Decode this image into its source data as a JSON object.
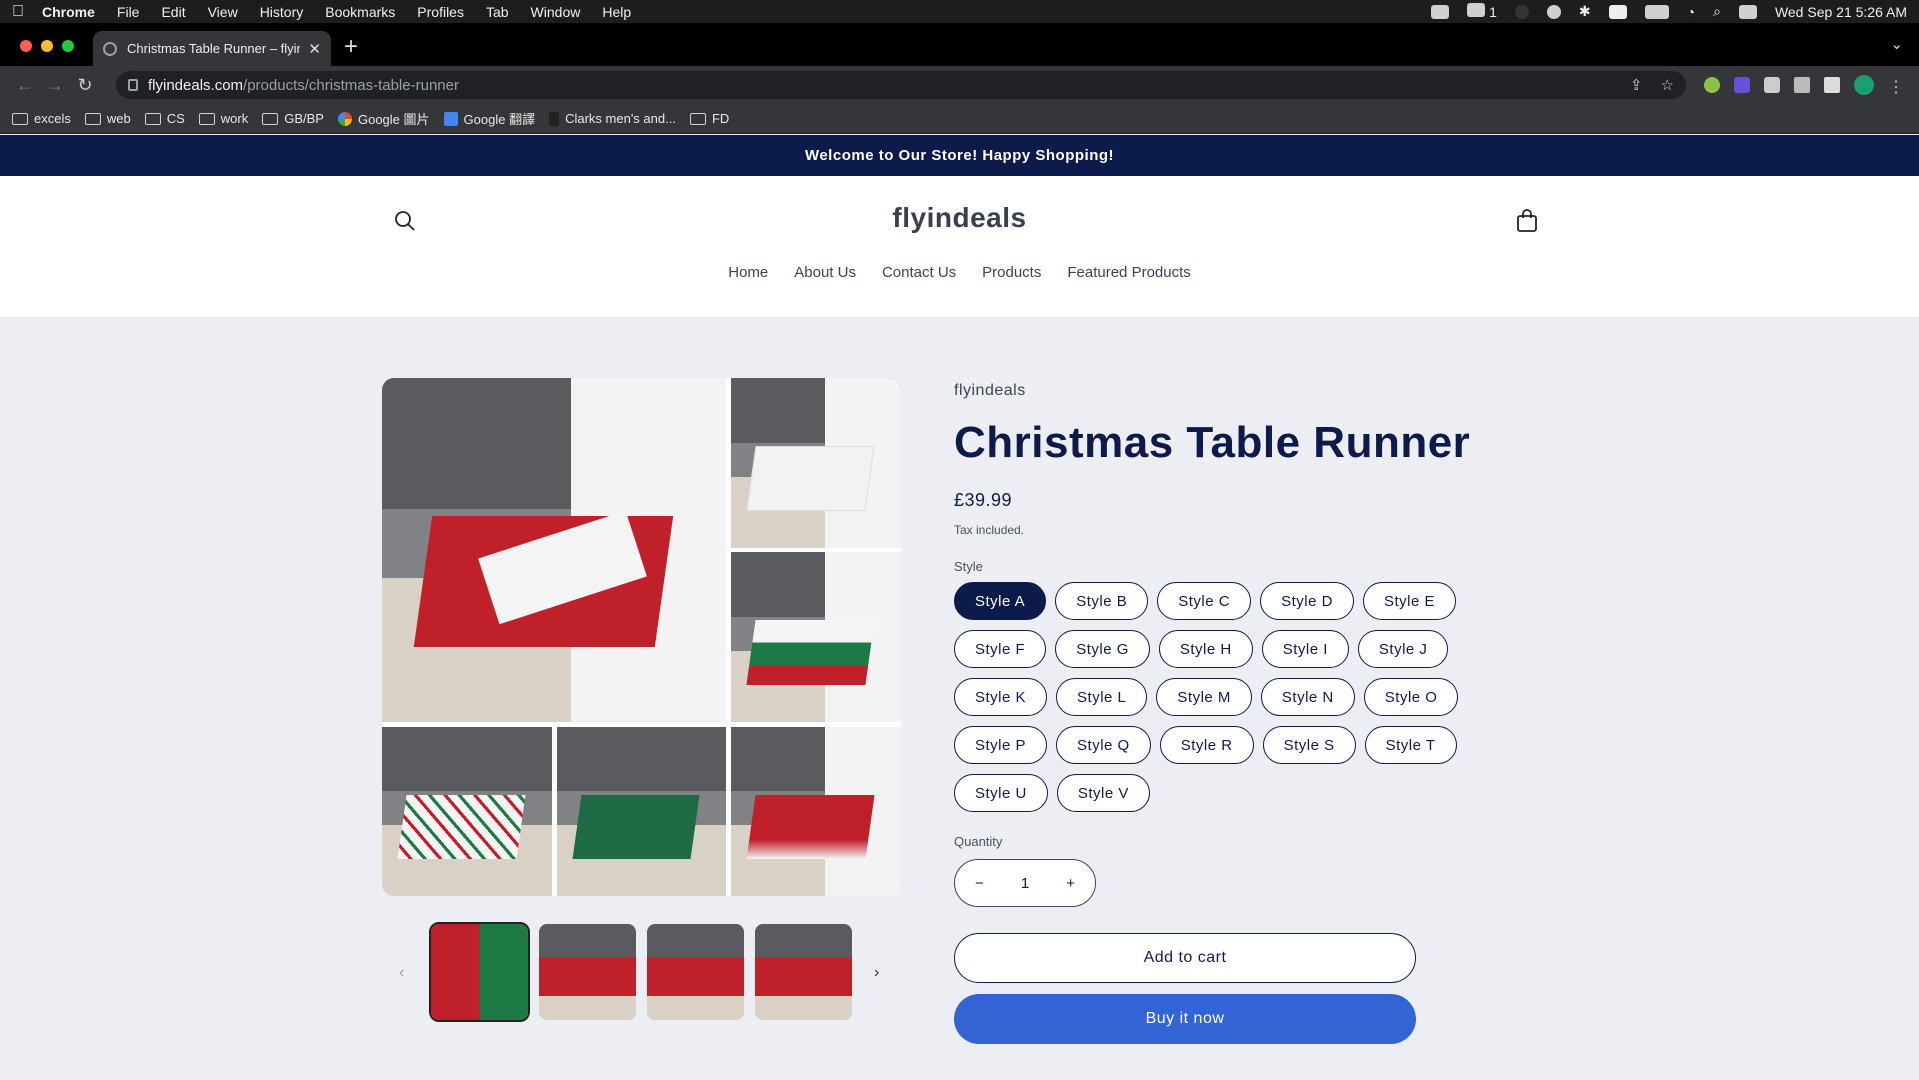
{
  "menubar": {
    "apple": "",
    "app": "Chrome",
    "items": [
      "File",
      "Edit",
      "View",
      "History",
      "Bookmarks",
      "Profiles",
      "Tab",
      "Window",
      "Help"
    ],
    "wechat_count": "1",
    "datetime": "Wed Sep 21  5:26 AM"
  },
  "browser": {
    "tab_title": "Christmas Table Runner – flyin",
    "url_host": "flyindeals.com",
    "url_path": "/products/christmas-table-runner",
    "bookmarks": [
      "excels",
      "web",
      "CS",
      "work",
      "GB/BP",
      "Google 圖片",
      "Google 翻譯",
      "Clarks men's and...",
      "FD"
    ]
  },
  "store": {
    "announcement": "Welcome to Our Store! Happy Shopping!",
    "logo": "flyindeals",
    "nav": [
      "Home",
      "About Us",
      "Contact Us",
      "Products",
      "Featured Products"
    ]
  },
  "product": {
    "vendor": "flyindeals",
    "title": "Christmas Table Runner",
    "price": "£39.99",
    "tax_note": "Tax included.",
    "style_label": "Style",
    "styles": [
      "Style A",
      "Style B",
      "Style C",
      "Style D",
      "Style E",
      "Style F",
      "Style G",
      "Style H",
      "Style I",
      "Style J",
      "Style K",
      "Style L",
      "Style M",
      "Style N",
      "Style O",
      "Style P",
      "Style Q",
      "Style R",
      "Style S",
      "Style T",
      "Style U",
      "Style V"
    ],
    "selected_style": "Style A",
    "quantity_label": "Quantity",
    "quantity": "1",
    "add_to_cart": "Add to cart",
    "buy_now": "Buy it now"
  },
  "colors": {
    "navy": "#0d1b4a",
    "buy_blue": "#3364d4",
    "red_cloth": "#c0202a",
    "green_cloth": "#1e7a45"
  }
}
